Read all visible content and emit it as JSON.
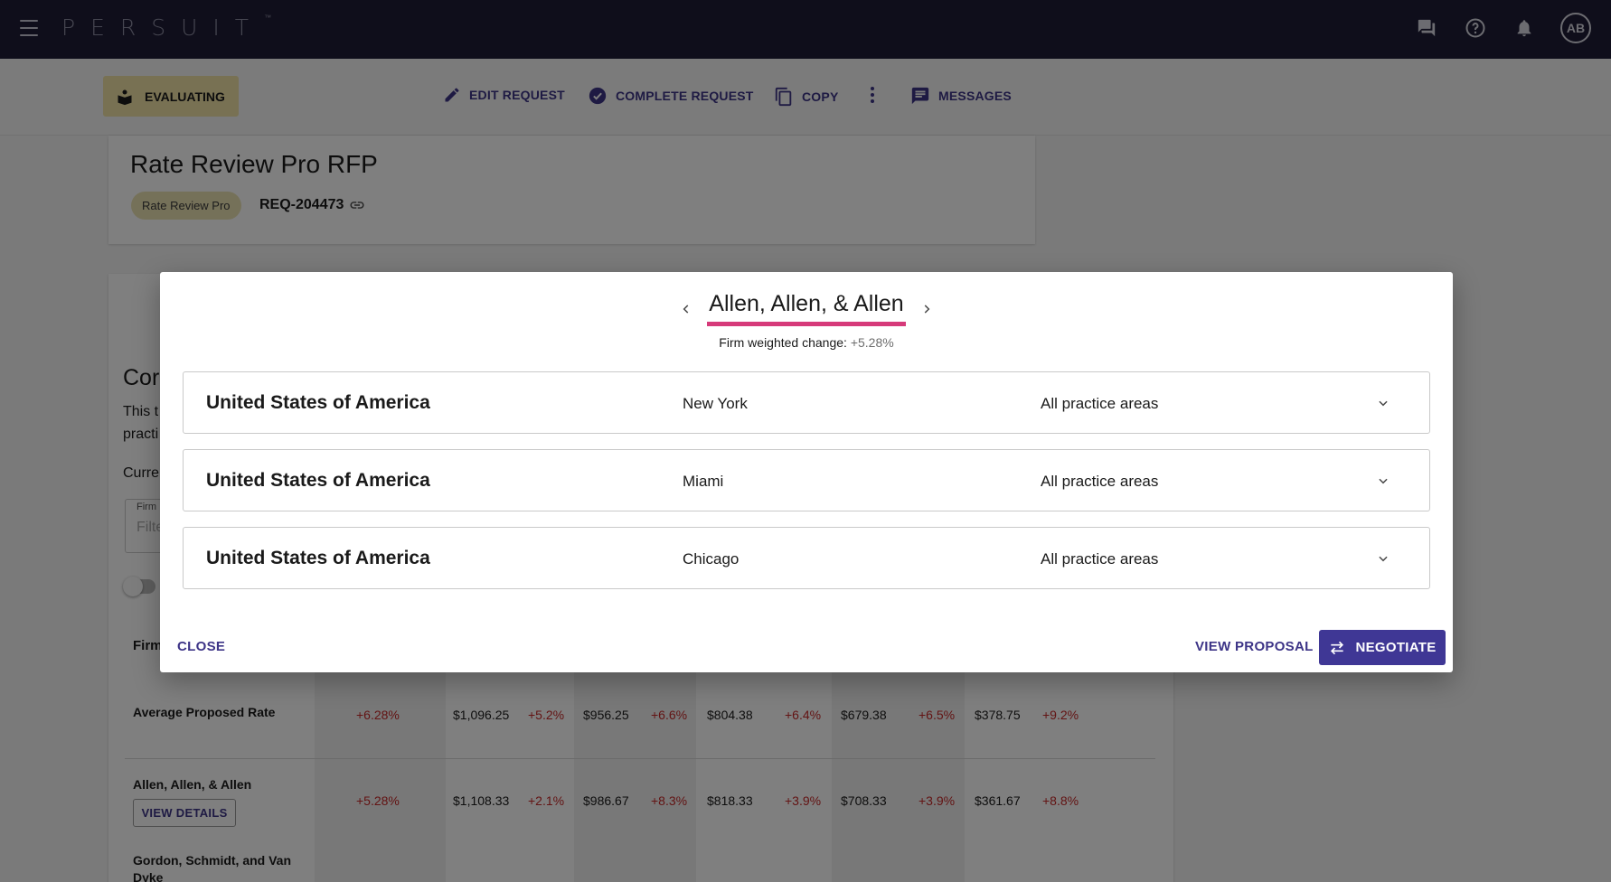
{
  "app": {
    "logo": "PERSUIT",
    "logo_tm": "™",
    "user_initials": "AB"
  },
  "actionbar": {
    "status_label": "EVALUATING",
    "edit_label": "EDIT REQUEST",
    "complete_label": "COMPLETE REQUEST",
    "copy_label": "COPY",
    "messages_label": "MESSAGES"
  },
  "request": {
    "title": "Rate Review Pro RFP",
    "badge": "Rate Review Pro",
    "id": "REQ-204473"
  },
  "background": {
    "section_title_fragment": "Cor",
    "desc_line1": "This t",
    "desc_line2": "practi",
    "current_fragment": "Curre",
    "filter_label": "Firm",
    "filter_placeholder": "Filte",
    "firm_col_fragment": "Firm",
    "avg_row": {
      "label": "Average Proposed Rate",
      "change": "+6.28%",
      "cells": [
        {
          "rate": "$1,096.25",
          "change": "+5.2%"
        },
        {
          "rate": "$956.25",
          "change": "+6.6%"
        },
        {
          "rate": "$804.38",
          "change": "+6.4%"
        },
        {
          "rate": "$679.38",
          "change": "+6.5%"
        },
        {
          "rate": "$378.75",
          "change": "+9.2%"
        }
      ]
    },
    "firm_row": {
      "label": "Allen, Allen, & Allen",
      "details_label": "VIEW DETAILS",
      "change": "+5.28%",
      "cells": [
        {
          "rate": "$1,108.33",
          "change": "+2.1%"
        },
        {
          "rate": "$986.67",
          "change": "+8.3%"
        },
        {
          "rate": "$818.33",
          "change": "+3.9%"
        },
        {
          "rate": "$708.33",
          "change": "+3.9%"
        },
        {
          "rate": "$361.67",
          "change": "+8.8%"
        }
      ]
    },
    "next_row_label": "Gordon, Schmidt, and Van Dyke"
  },
  "modal": {
    "firm_name": "Allen, Allen, & Allen",
    "weighted_label": "Firm weighted change:",
    "weighted_value": "+5.28%",
    "regions": [
      {
        "country": "United States of America",
        "city": "New York",
        "practice": "All practice areas"
      },
      {
        "country": "United States of America",
        "city": "Miami",
        "practice": "All practice areas"
      },
      {
        "country": "United States of America",
        "city": "Chicago",
        "practice": "All practice areas"
      }
    ],
    "close_label": "CLOSE",
    "view_proposal_label": "VIEW PROPOSAL",
    "negotiate_label": "NEGOTIATE"
  },
  "colors": {
    "nav_bg": "#1f1d36",
    "accent": "#3f3795",
    "status_bg": "#f1e3a6",
    "underline": "#d63a7a",
    "increase": "#c62828"
  }
}
